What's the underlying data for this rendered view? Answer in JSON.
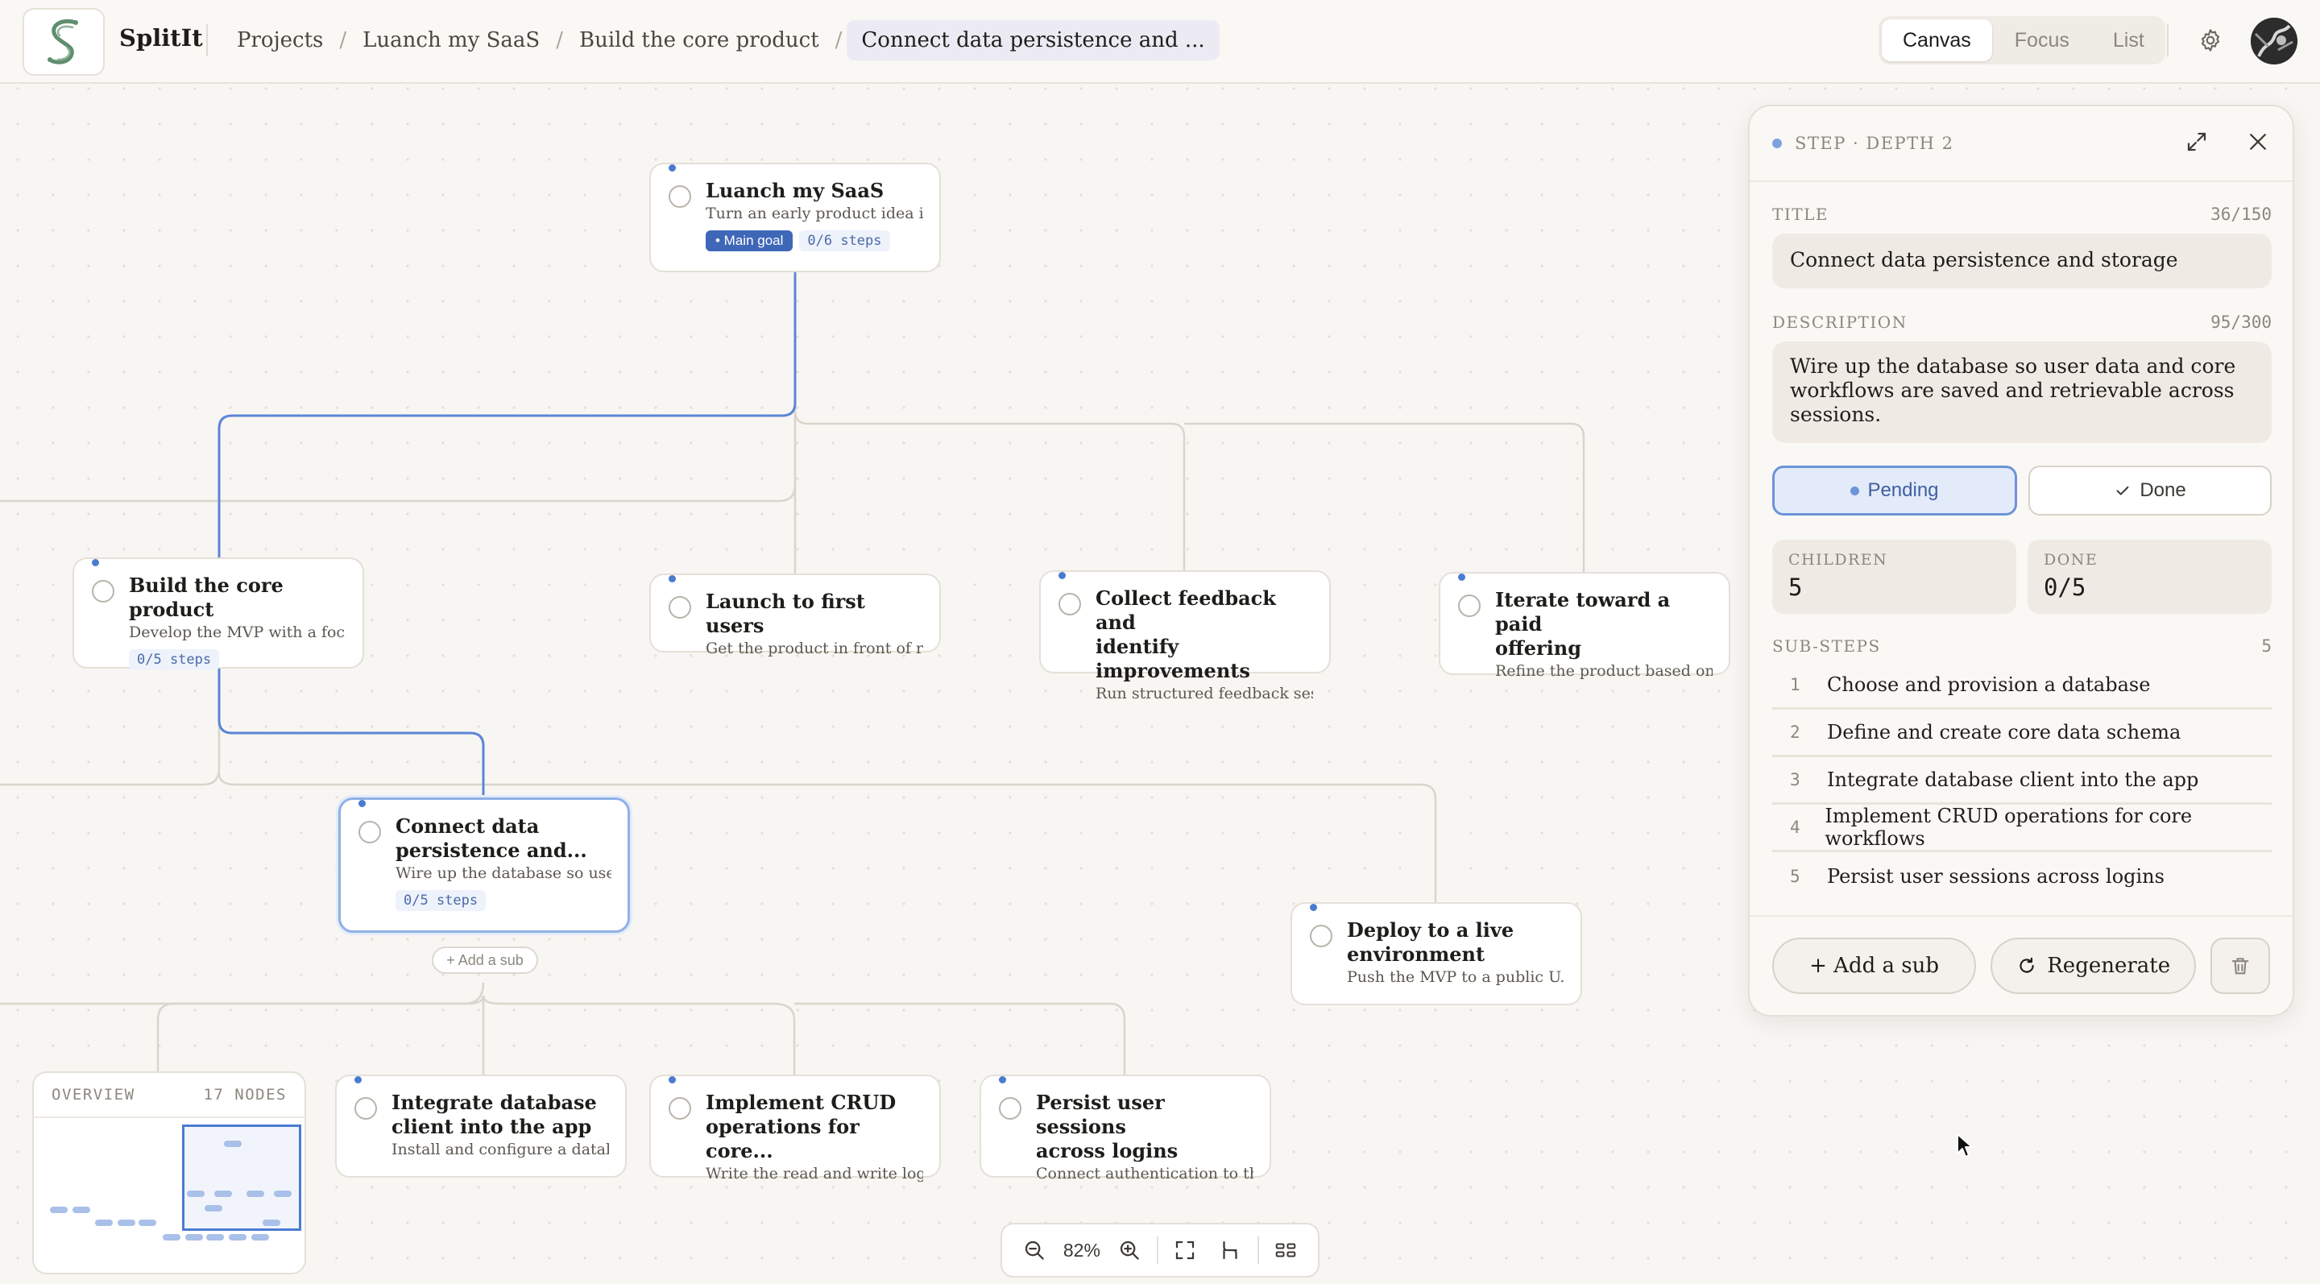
{
  "app": {
    "name": "SplitIt"
  },
  "breadcrumbs": [
    "Projects",
    "Luanch my SaaS",
    "Build the core product",
    "Connect data persistence and ..."
  ],
  "view_modes": {
    "options": [
      "Canvas",
      "Focus",
      "List"
    ],
    "selected": "Canvas"
  },
  "nodes": {
    "root": {
      "title": "Luanch my SaaS",
      "desc": "Turn an early product idea i...",
      "badge": "• Main goal",
      "steps": "0/6 steps"
    },
    "build": {
      "title": "Build the core product",
      "desc": "Develop the MVP with a foc...",
      "steps": "0/5 steps"
    },
    "launch": {
      "title": "Launch to first users",
      "desc": "Get the product in front of re..."
    },
    "collect": {
      "title_line1": "Collect feedback and",
      "title_line2": "identify improvements",
      "desc": "Run structured feedback ses..."
    },
    "iterate": {
      "title_line1": "Iterate toward a paid",
      "title_line2": "offering",
      "desc": "Refine the product based on ..."
    },
    "connect": {
      "title_line1": "Connect data",
      "title_line2": "persistence and...",
      "desc": "Wire up the database so user...",
      "steps": "0/5 steps"
    },
    "deploy": {
      "title_line1": "Deploy to a live",
      "title_line2": "environment",
      "desc": "Push the MVP to a public U..."
    },
    "integrate": {
      "title_line1": "Integrate database",
      "title_line2": "client into the app",
      "desc": "Install and configure a datab..."
    },
    "crud": {
      "title_line1": "Implement CRUD",
      "title_line2": "operations for core...",
      "desc": "Write the read and write logi..."
    },
    "persist": {
      "title_line1": "Persist user sessions",
      "title_line2": "across logins",
      "desc": "Connect authentication to th..."
    }
  },
  "add_sub_chip": "+ Add a sub",
  "overview": {
    "label": "OVERVIEW",
    "count": "17 NODES"
  },
  "zoom": {
    "level": "82%"
  },
  "panel": {
    "kind": "STEP · DEPTH 2",
    "title_label": "TITLE",
    "title_count": "36/150",
    "title_value": "Connect data persistence and storage",
    "desc_label": "DESCRIPTION",
    "desc_count": "95/300",
    "desc_value": "Wire up the database so user data and core workflows are saved and retrievable across sessions.",
    "status": {
      "pending": "Pending",
      "done": "Done",
      "selected": "Pending"
    },
    "children_label": "CHILDREN",
    "children_value": "5",
    "done_label": "DONE",
    "done_value": "0/5",
    "substeps_label": "SUB-STEPS",
    "substeps_count": "5",
    "substeps": [
      {
        "n": "1",
        "label": "Choose and provision a database"
      },
      {
        "n": "2",
        "label": "Define and create core data schema"
      },
      {
        "n": "3",
        "label": "Integrate database client into the app"
      },
      {
        "n": "4",
        "label": "Implement CRUD operations for core workflows"
      },
      {
        "n": "5",
        "label": "Persist user sessions across logins"
      }
    ],
    "add_sub": "+ Add a sub",
    "regenerate": "Regenerate"
  },
  "colors": {
    "accent": "#4a7bd0",
    "edge": "#d9d5cc",
    "edge_active": "#5b86d6",
    "background": "#f8f6f2"
  },
  "icons": [
    "app-logo",
    "gear-icon",
    "expand-icon",
    "close-icon",
    "zoom-out-icon",
    "zoom-in-icon",
    "fit-view-icon",
    "auto-layout-icon",
    "grid-icon",
    "refresh-icon",
    "trash-icon",
    "check-icon"
  ]
}
